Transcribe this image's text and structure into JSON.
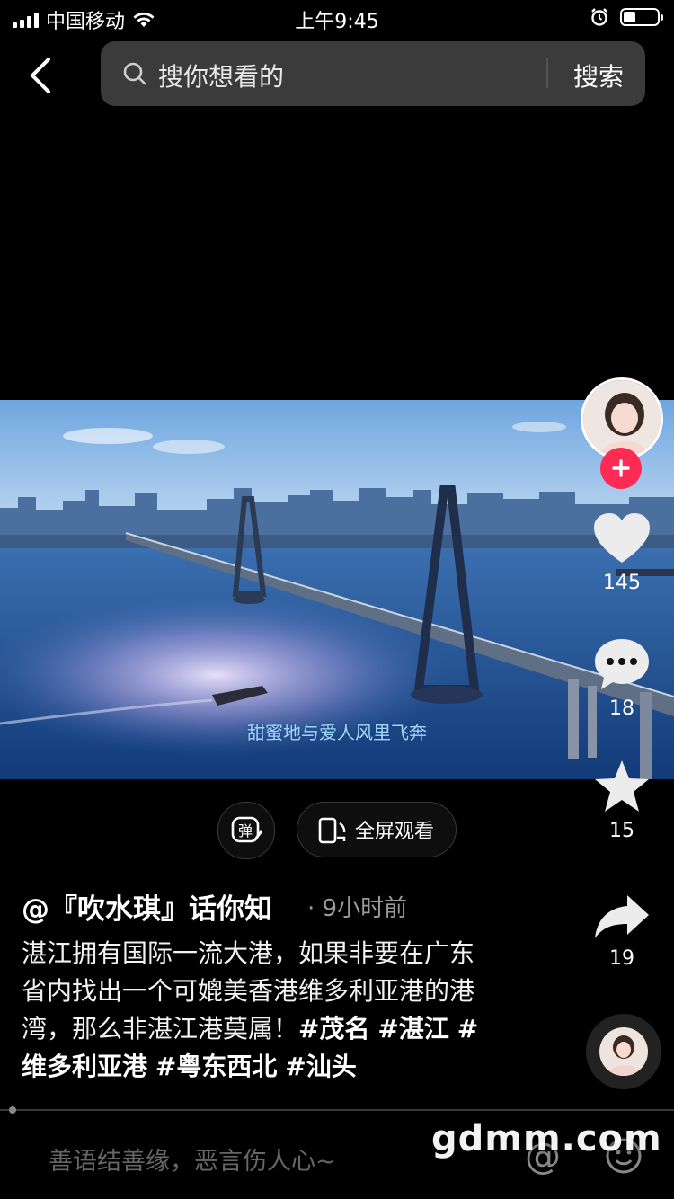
{
  "status_bar": {
    "carrier": "中国移动",
    "time": "上午9:45",
    "battery_level": 0.35
  },
  "search": {
    "placeholder": "搜你想看的",
    "button_label": "搜索"
  },
  "video": {
    "subtitle": "甜蜜地与爱人风里飞奔"
  },
  "controls": {
    "danmu_label": "弹",
    "fullscreen_label": "全屏观看"
  },
  "actions": {
    "likes": "145",
    "comments": "18",
    "favorites": "15",
    "shares": "19"
  },
  "post": {
    "author": "@『吹水琪』话你知",
    "time_ago": "· 9小时前",
    "description": "湛江拥有国际一流大港，如果非要在广东省内找出一个可媲美香港维多利亚港的港湾，那么非湛江港莫属！",
    "hashtags": [
      "#茂名",
      "#湛江",
      "#维多利亚港",
      "#粤东西北",
      "#汕头"
    ]
  },
  "comment_bar": {
    "placeholder": "善语结善缘，恶言伤人心~",
    "at_symbol": "@"
  },
  "watermark": "gdmm.com",
  "icons": [
    "signal-icon",
    "wifi-icon",
    "alarm-icon",
    "battery-icon",
    "back-icon",
    "search-icon",
    "danmu-icon",
    "fullscreen-icon",
    "follow-plus-icon",
    "heart-icon",
    "comment-icon",
    "star-icon",
    "share-icon",
    "music-disc-icon",
    "at-icon",
    "emoji-icon"
  ],
  "colors": {
    "background": "#000000",
    "search_bg": "#3b3b3b",
    "follow_red": "#fe2c55",
    "subtitle_blue": "#9fd8ff"
  }
}
